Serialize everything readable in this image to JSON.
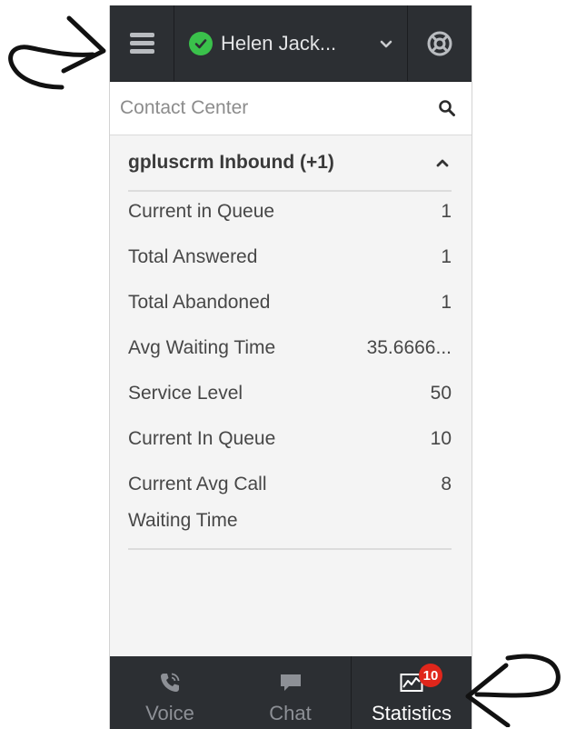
{
  "header": {
    "user_name": "Helen Jack...",
    "status_color": "#3ac14b"
  },
  "search": {
    "placeholder": "Contact Center"
  },
  "group": {
    "title": "gpluscrm Inbound (+1)",
    "stats": [
      {
        "label": "Current in Queue",
        "value": "1"
      },
      {
        "label": "Total Answered",
        "value": "1"
      },
      {
        "label": "Total Abandoned",
        "value": "1"
      },
      {
        "label": "Avg Waiting Time",
        "value": "35.6666..."
      },
      {
        "label": "Service Level",
        "value": "50"
      },
      {
        "label": "Current In Queue",
        "value": "10"
      },
      {
        "label": "Current Avg Call Waiting Time",
        "value": "8"
      }
    ]
  },
  "tabs": {
    "voice": "Voice",
    "chat": "Chat",
    "statistics": "Statistics",
    "statistics_badge": "10",
    "active": "statistics"
  },
  "icons": {
    "menu": "hamburger-icon",
    "status": "check-circle-icon",
    "dropdown": "chevron-down-icon",
    "help": "lifebuoy-icon",
    "search": "search-icon",
    "collapse": "chevron-up-icon",
    "voice": "phone-icon",
    "chat": "chat-bubble-icon",
    "statistics": "chart-icon"
  }
}
